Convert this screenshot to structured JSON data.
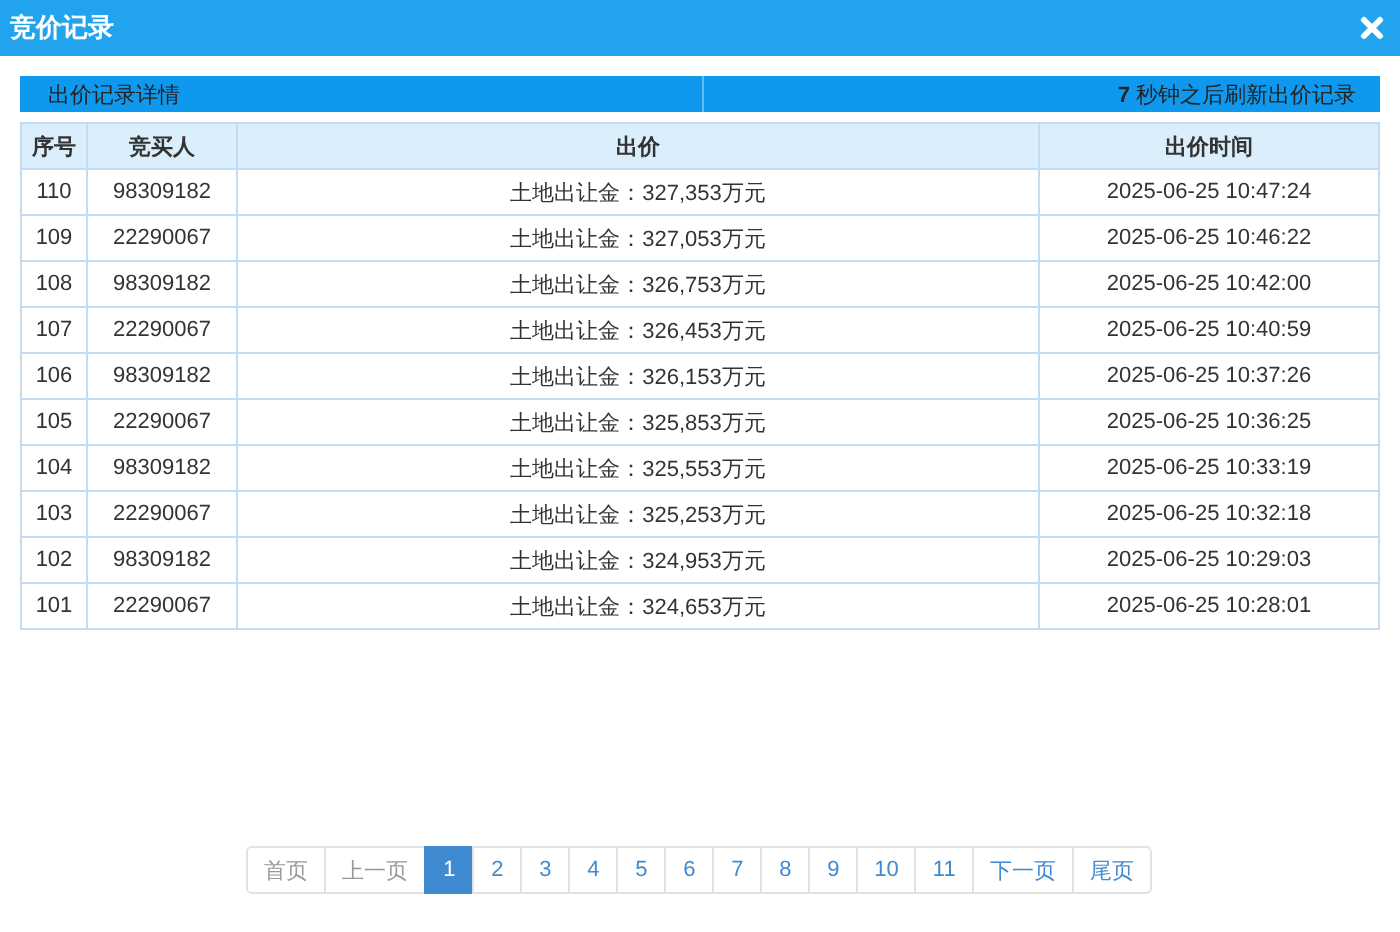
{
  "window": {
    "title": "竞价记录"
  },
  "info_bar": {
    "left": "出价记录详情",
    "right": "**7** 秒钟之后刷新出价记录"
  },
  "table": {
    "columns": [
      "序号",
      "竞买人",
      "出价",
      "出价时间"
    ],
    "rows": [
      [
        "110",
        "98309182",
        "土地出让金：327,353万元",
        "2025-06-25 10:47:24"
      ],
      [
        "109",
        "22290067",
        "土地出让金：327,053万元",
        "2025-06-25 10:46:22"
      ],
      [
        "108",
        "98309182",
        "土地出让金：326,753万元",
        "2025-06-25 10:42:00"
      ],
      [
        "107",
        "22290067",
        "土地出让金：326,453万元",
        "2025-06-25 10:40:59"
      ],
      [
        "106",
        "98309182",
        "土地出让金：326,153万元",
        "2025-06-25 10:37:26"
      ],
      [
        "105",
        "22290067",
        "土地出让金：325,853万元",
        "2025-06-25 10:36:25"
      ],
      [
        "104",
        "98309182",
        "土地出让金：325,553万元",
        "2025-06-25 10:33:19"
      ],
      [
        "103",
        "22290067",
        "土地出让金：325,253万元",
        "2025-06-25 10:32:18"
      ],
      [
        "102",
        "98309182",
        "土地出让金：324,953万元",
        "2025-06-25 10:29:03"
      ],
      [
        "101",
        "22290067",
        "土地出让金：324,653万元",
        "2025-06-25 10:28:01"
      ]
    ]
  },
  "pagination": [
    {
      "label": "首页",
      "selected": false,
      "disabled": true
    },
    {
      "label": "上一页",
      "selected": false,
      "disabled": true
    },
    {
      "label": "1",
      "selected": true,
      "disabled": false
    },
    {
      "label": "2",
      "selected": false,
      "disabled": false
    },
    {
      "label": "3",
      "selected": false,
      "disabled": false
    },
    {
      "label": "4",
      "selected": false,
      "disabled": false
    },
    {
      "label": "5",
      "selected": false,
      "disabled": false
    },
    {
      "label": "6",
      "selected": false,
      "disabled": false
    },
    {
      "label": "7",
      "selected": false,
      "disabled": false
    },
    {
      "label": "8",
      "selected": false,
      "disabled": false
    },
    {
      "label": "9",
      "selected": false,
      "disabled": false
    },
    {
      "label": "10",
      "selected": false,
      "disabled": false
    },
    {
      "label": "11",
      "selected": false,
      "disabled": false
    },
    {
      "label": "下一页",
      "selected": false,
      "disabled": false
    },
    {
      "label": "尾页",
      "selected": false,
      "disabled": false
    }
  ]
}
